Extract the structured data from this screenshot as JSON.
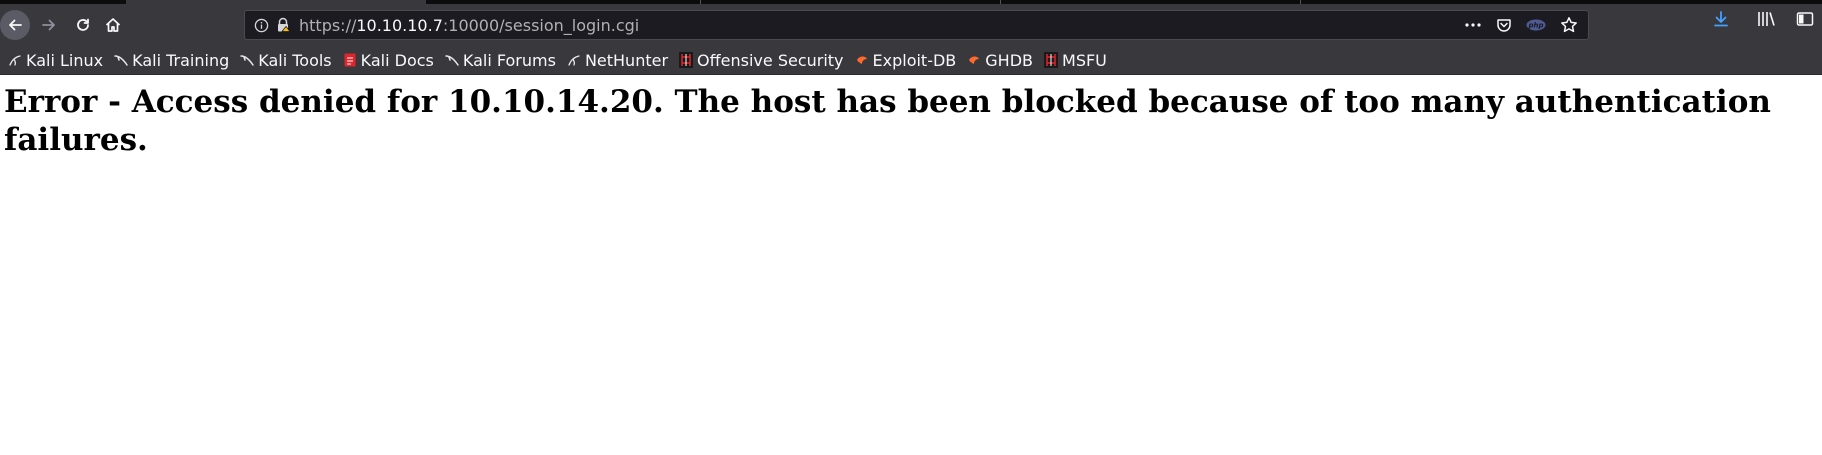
{
  "toolbar": {
    "url_scheme": "https://",
    "url_host": "10.10.10.7",
    "url_rest": ":10000/session_login.cgi",
    "icons": [
      "back-icon",
      "forward-icon",
      "reload-icon",
      "home-icon",
      "info-icon",
      "insecure-lock-icon",
      "more-icon",
      "pocket-icon",
      "php-icon",
      "star-icon",
      "download-icon",
      "library-icon",
      "sidebar-icon",
      "account-icon"
    ]
  },
  "bookmarks": [
    {
      "label": "Kali Linux",
      "icon": "kali-dragon-icon"
    },
    {
      "label": "Kali Training",
      "icon": "kali-dragon-icon"
    },
    {
      "label": "Kali Tools",
      "icon": "kali-dragon-icon"
    },
    {
      "label": "Kali Docs",
      "icon": "kali-docs-icon"
    },
    {
      "label": "Kali Forums",
      "icon": "kali-dragon-icon"
    },
    {
      "label": "NetHunter",
      "icon": "nethunter-icon"
    },
    {
      "label": "Offensive Security",
      "icon": "offsec-icon"
    },
    {
      "label": "Exploit-DB",
      "icon": "exploitdb-icon"
    },
    {
      "label": "GHDB",
      "icon": "exploitdb-icon"
    },
    {
      "label": "MSFU",
      "icon": "offsec-icon"
    }
  ],
  "page": {
    "error_message": "Error - Access denied for 10.10.14.20. The host has been blocked because of too many authentication failures."
  },
  "colors": {
    "chrome": "#38383d",
    "urlbar": "#1c1b22",
    "download_accent": "#45a1ff",
    "page_bg": "#ffffff"
  }
}
